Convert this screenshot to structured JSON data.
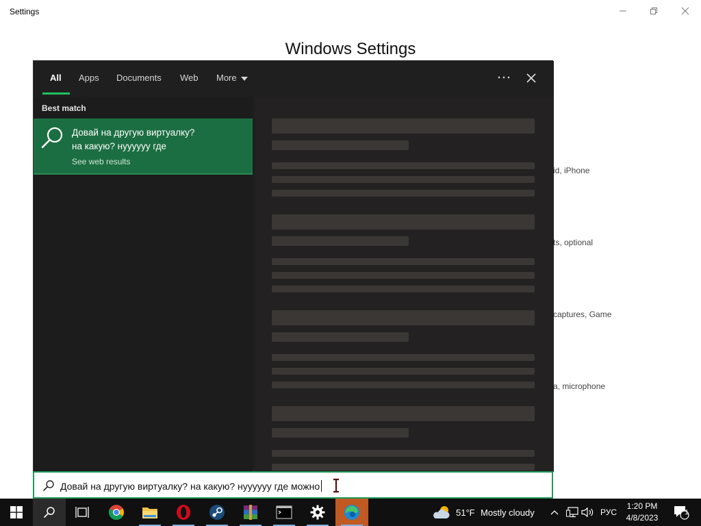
{
  "window": {
    "title": "Settings",
    "heading": "Windows Settings",
    "background_descriptions": [
      "id, iPhone",
      "ts, optional",
      "captures, Game",
      "a, microphone"
    ]
  },
  "search_flyout": {
    "tabs": [
      {
        "label": "All",
        "active": true
      },
      {
        "label": "Apps",
        "active": false
      },
      {
        "label": "Documents",
        "active": false
      },
      {
        "label": "Web",
        "active": false
      },
      {
        "label": "More",
        "active": false
      }
    ],
    "options_icon": "more-options-icon",
    "close_icon": "close-icon",
    "best_match": {
      "section_label": "Best match",
      "title_line1": "Довай на другую виртуалку?",
      "title_line2": "на какую? нуууууу где",
      "subtitle": "See web results",
      "icon": "search-icon"
    }
  },
  "search_box": {
    "value": "Довай на другую виртуалку? на какую? нуууууу где можно",
    "icon": "search-icon"
  },
  "taskbar": {
    "apps": [
      {
        "name": "start-button",
        "icon": "windows-logo-icon"
      },
      {
        "name": "search-button",
        "icon": "search-icon"
      },
      {
        "name": "task-view-button",
        "icon": "task-view-icon"
      },
      {
        "name": "chrome",
        "icon": "chrome-icon"
      },
      {
        "name": "file-explorer",
        "icon": "folder-icon"
      },
      {
        "name": "opera",
        "icon": "opera-icon"
      },
      {
        "name": "steam",
        "icon": "steam-icon"
      },
      {
        "name": "winrar",
        "icon": "winrar-icon"
      },
      {
        "name": "terminal",
        "icon": "terminal-icon"
      },
      {
        "name": "settings",
        "icon": "gear-icon"
      },
      {
        "name": "edge",
        "icon": "edge-icon"
      }
    ],
    "weather": {
      "temperature": "51°F",
      "condition": "Mostly cloudy",
      "icon": "cloud-sun-icon"
    },
    "language": "РУС",
    "clock": {
      "time": "1:20 PM",
      "date": "4/8/2023"
    },
    "notification_count": "1"
  }
}
